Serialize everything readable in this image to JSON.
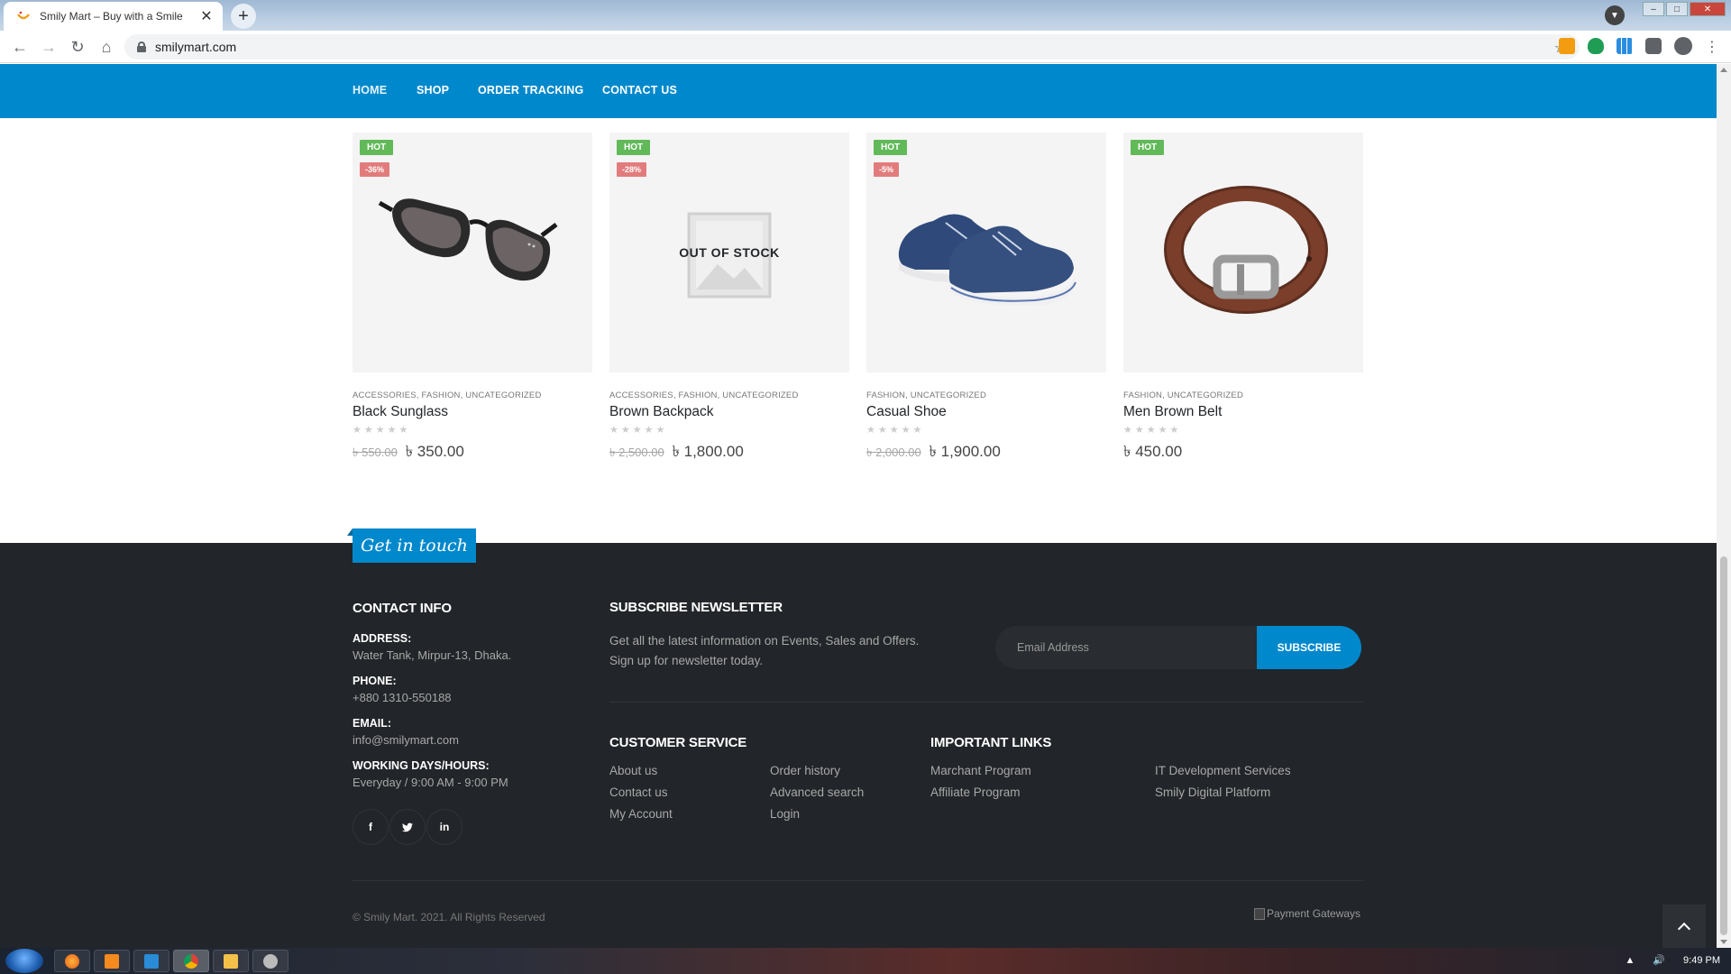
{
  "browser": {
    "tab_title": "Smily Mart – Buy with a Smile",
    "tab_close": "✕",
    "new_tab": "+",
    "url": "smilymart.com",
    "star": "☆"
  },
  "nav": {
    "items": [
      "HOME",
      "SHOP",
      "ORDER TRACKING",
      "CONTACT US"
    ]
  },
  "products": [
    {
      "name": "Black Sunglass",
      "categories": "ACCESSORIES, FASHION, UNCATEGORIZED",
      "hot": "HOT",
      "discount": "-36%",
      "old_price": "৳ 550.00",
      "price": "৳ 350.00",
      "stars": "★★★★★",
      "rating": 0
    },
    {
      "name": "Brown Backpack",
      "categories": "ACCESSORIES, FASHION, UNCATEGORIZED",
      "hot": "HOT",
      "discount": "-28%",
      "old_price": "৳ 2,500.00",
      "price": "৳ 1,800.00",
      "stars": "★★★★★",
      "rating": 0,
      "out_of_stock": "OUT OF STOCK"
    },
    {
      "name": "Casual Shoe",
      "categories": "FASHION, UNCATEGORIZED",
      "hot": "HOT",
      "discount": "-5%",
      "old_price": "৳ 2,000.00",
      "price": "৳ 1,900.00",
      "stars": "★★★★★",
      "rating": 0
    },
    {
      "name": "Men Brown Belt",
      "categories": "FASHION, UNCATEGORIZED",
      "hot": "HOT",
      "price": "৳ 450.00",
      "stars": "★★★★★",
      "rating": 0
    }
  ],
  "footer": {
    "get_in_touch": "Get in touch",
    "contact": {
      "heading": "CONTACT INFO",
      "address_label": "ADDRESS:",
      "address": "Water Tank, Mirpur-13, Dhaka.",
      "phone_label": "PHONE:",
      "phone": "+880 1310-550188",
      "email_label": "EMAIL:",
      "email": "info@smilymart.com",
      "hours_label": "WORKING DAYS/HOURS:",
      "hours": "Everyday / 9:00 AM - 9:00 PM"
    },
    "social": {
      "facebook": "f",
      "twitter": "🐦",
      "linkedin": "in"
    },
    "newsletter": {
      "heading": "SUBSCRIBE NEWSLETTER",
      "line1": "Get all the latest information on Events, Sales and Offers.",
      "line2": "Sign up for newsletter today.",
      "placeholder": "Email Address",
      "button": "SUBSCRIBE"
    },
    "customer_service": {
      "heading": "CUSTOMER SERVICE",
      "col1": [
        "About us",
        "Contact us",
        "My Account"
      ],
      "col2": [
        "Order history",
        "Advanced search",
        "Login"
      ]
    },
    "important_links": {
      "heading": "IMPORTANT LINKS",
      "col1": [
        "Marchant Program",
        "Affiliate Program"
      ],
      "col2": [
        "IT Development Services",
        "Smily Digital Platform"
      ]
    },
    "copyright": "© Smily Mart. 2021. All Rights Reserved",
    "payment_alt": "Payment Gateways"
  },
  "taskbar": {
    "time": "9:49 PM"
  },
  "colors": {
    "brand_blue": "#0088cc",
    "footer_bg": "#222529",
    "hot_badge": "#62b959",
    "sale_badge": "#e27c7c"
  }
}
